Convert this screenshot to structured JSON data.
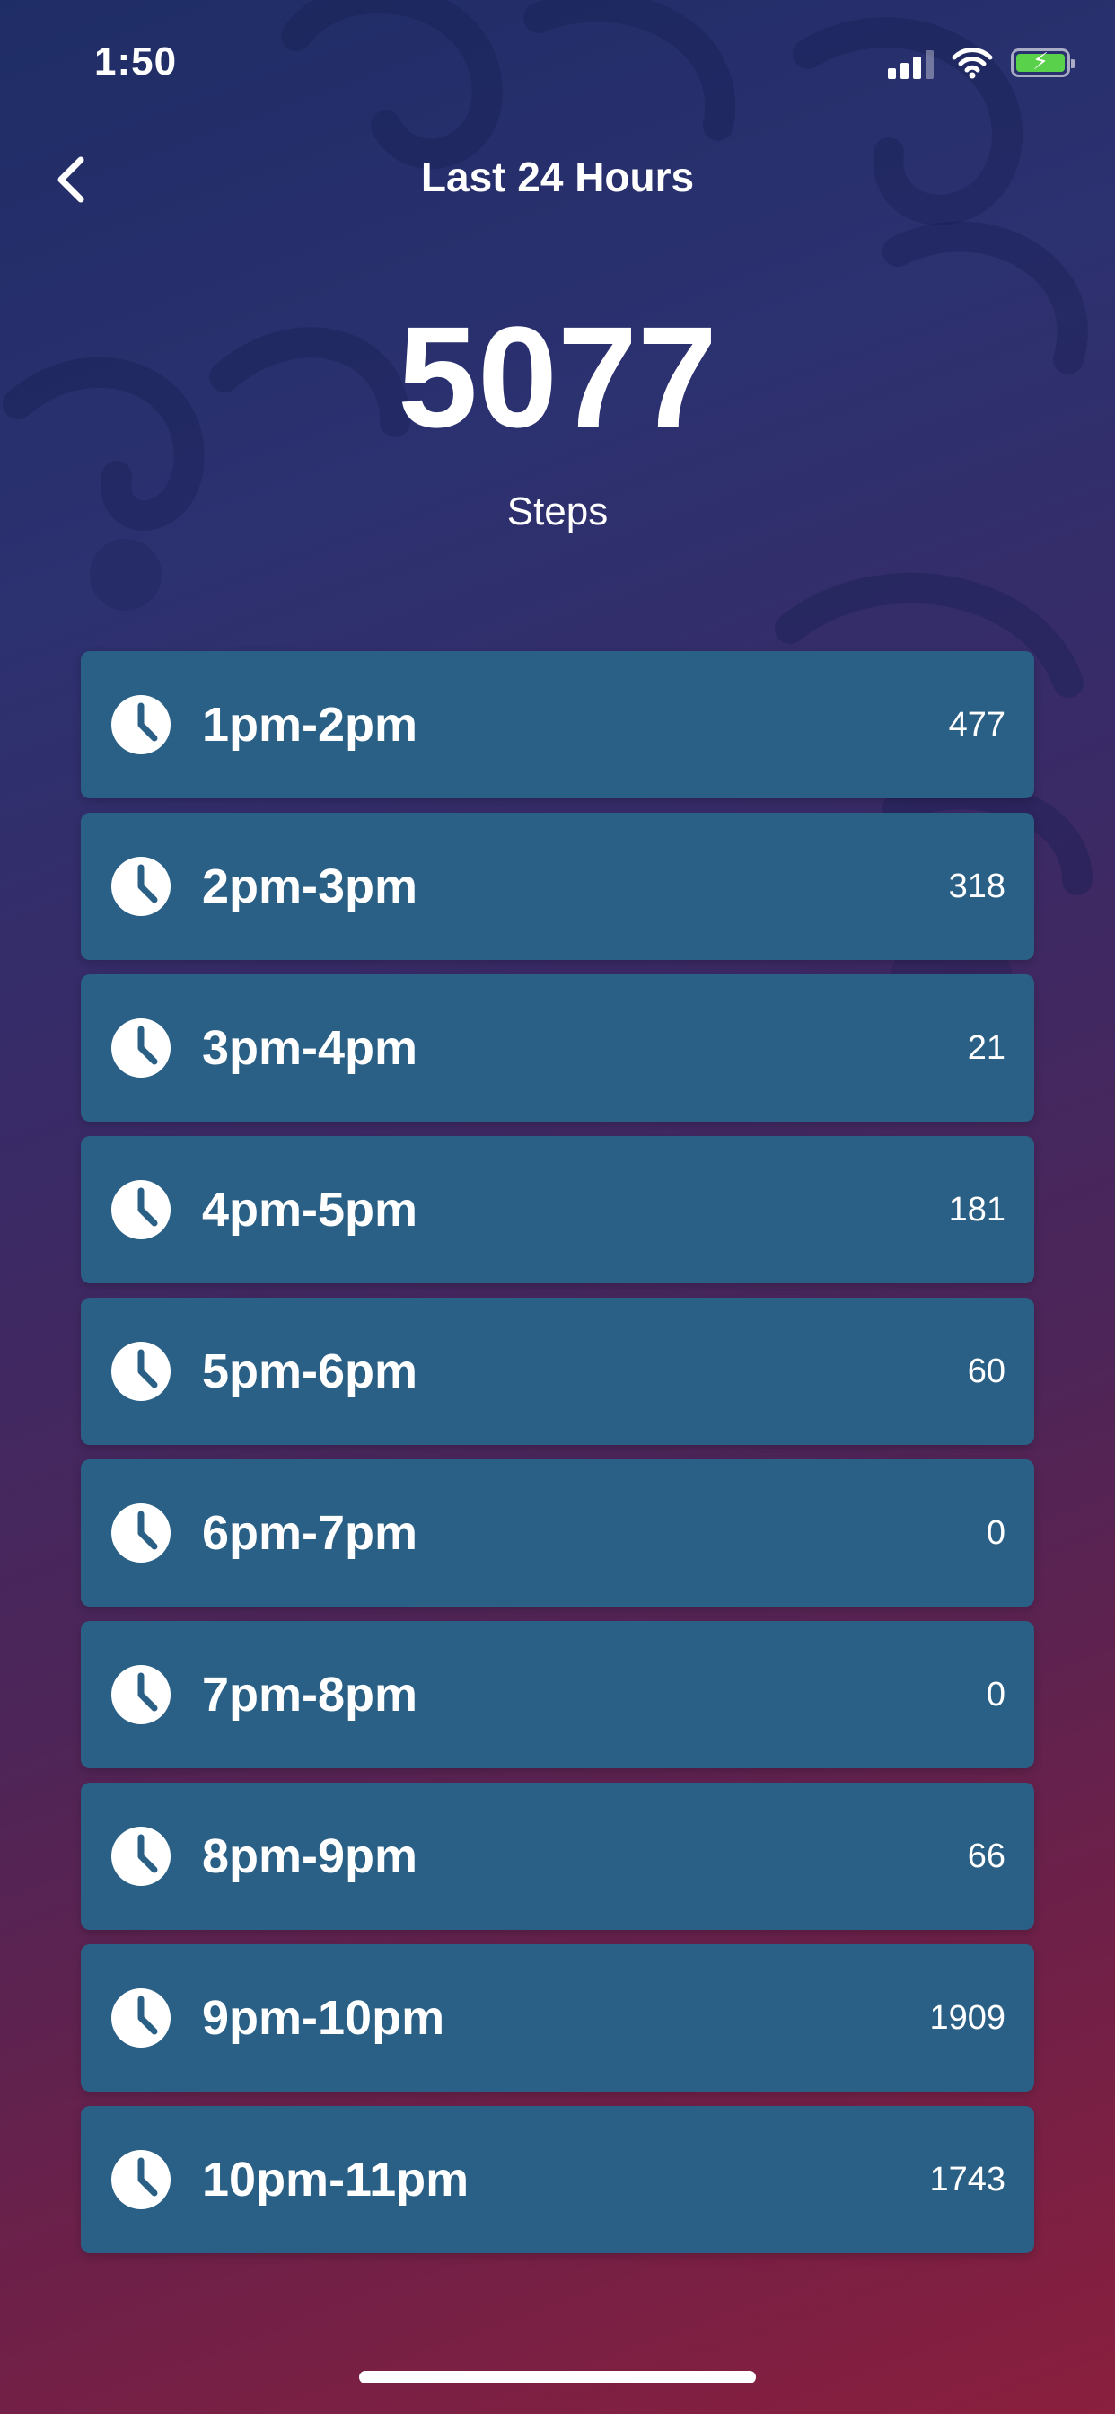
{
  "status_bar": {
    "time": "1:50",
    "icons": [
      "cellular-signal-icon",
      "wifi-icon",
      "battery-charging-icon"
    ],
    "battery_color": "#5ad14a"
  },
  "nav": {
    "back_icon": "chevron-left-icon",
    "title": "Last 24 Hours"
  },
  "summary": {
    "total": "5077",
    "unit": "Steps"
  },
  "colors": {
    "row_background": "#2a6085",
    "background_top": "#1f2d66",
    "background_bottom": "#8a1f3e"
  },
  "hours": [
    {
      "range": "1pm-2pm",
      "steps": "477"
    },
    {
      "range": "2pm-3pm",
      "steps": "318"
    },
    {
      "range": "3pm-4pm",
      "steps": "21"
    },
    {
      "range": "4pm-5pm",
      "steps": "181"
    },
    {
      "range": "5pm-6pm",
      "steps": "60"
    },
    {
      "range": "6pm-7pm",
      "steps": "0"
    },
    {
      "range": "7pm-8pm",
      "steps": "0"
    },
    {
      "range": "8pm-9pm",
      "steps": "66"
    },
    {
      "range": "9pm-10pm",
      "steps": "1909"
    },
    {
      "range": "10pm-11pm",
      "steps": "1743"
    }
  ]
}
